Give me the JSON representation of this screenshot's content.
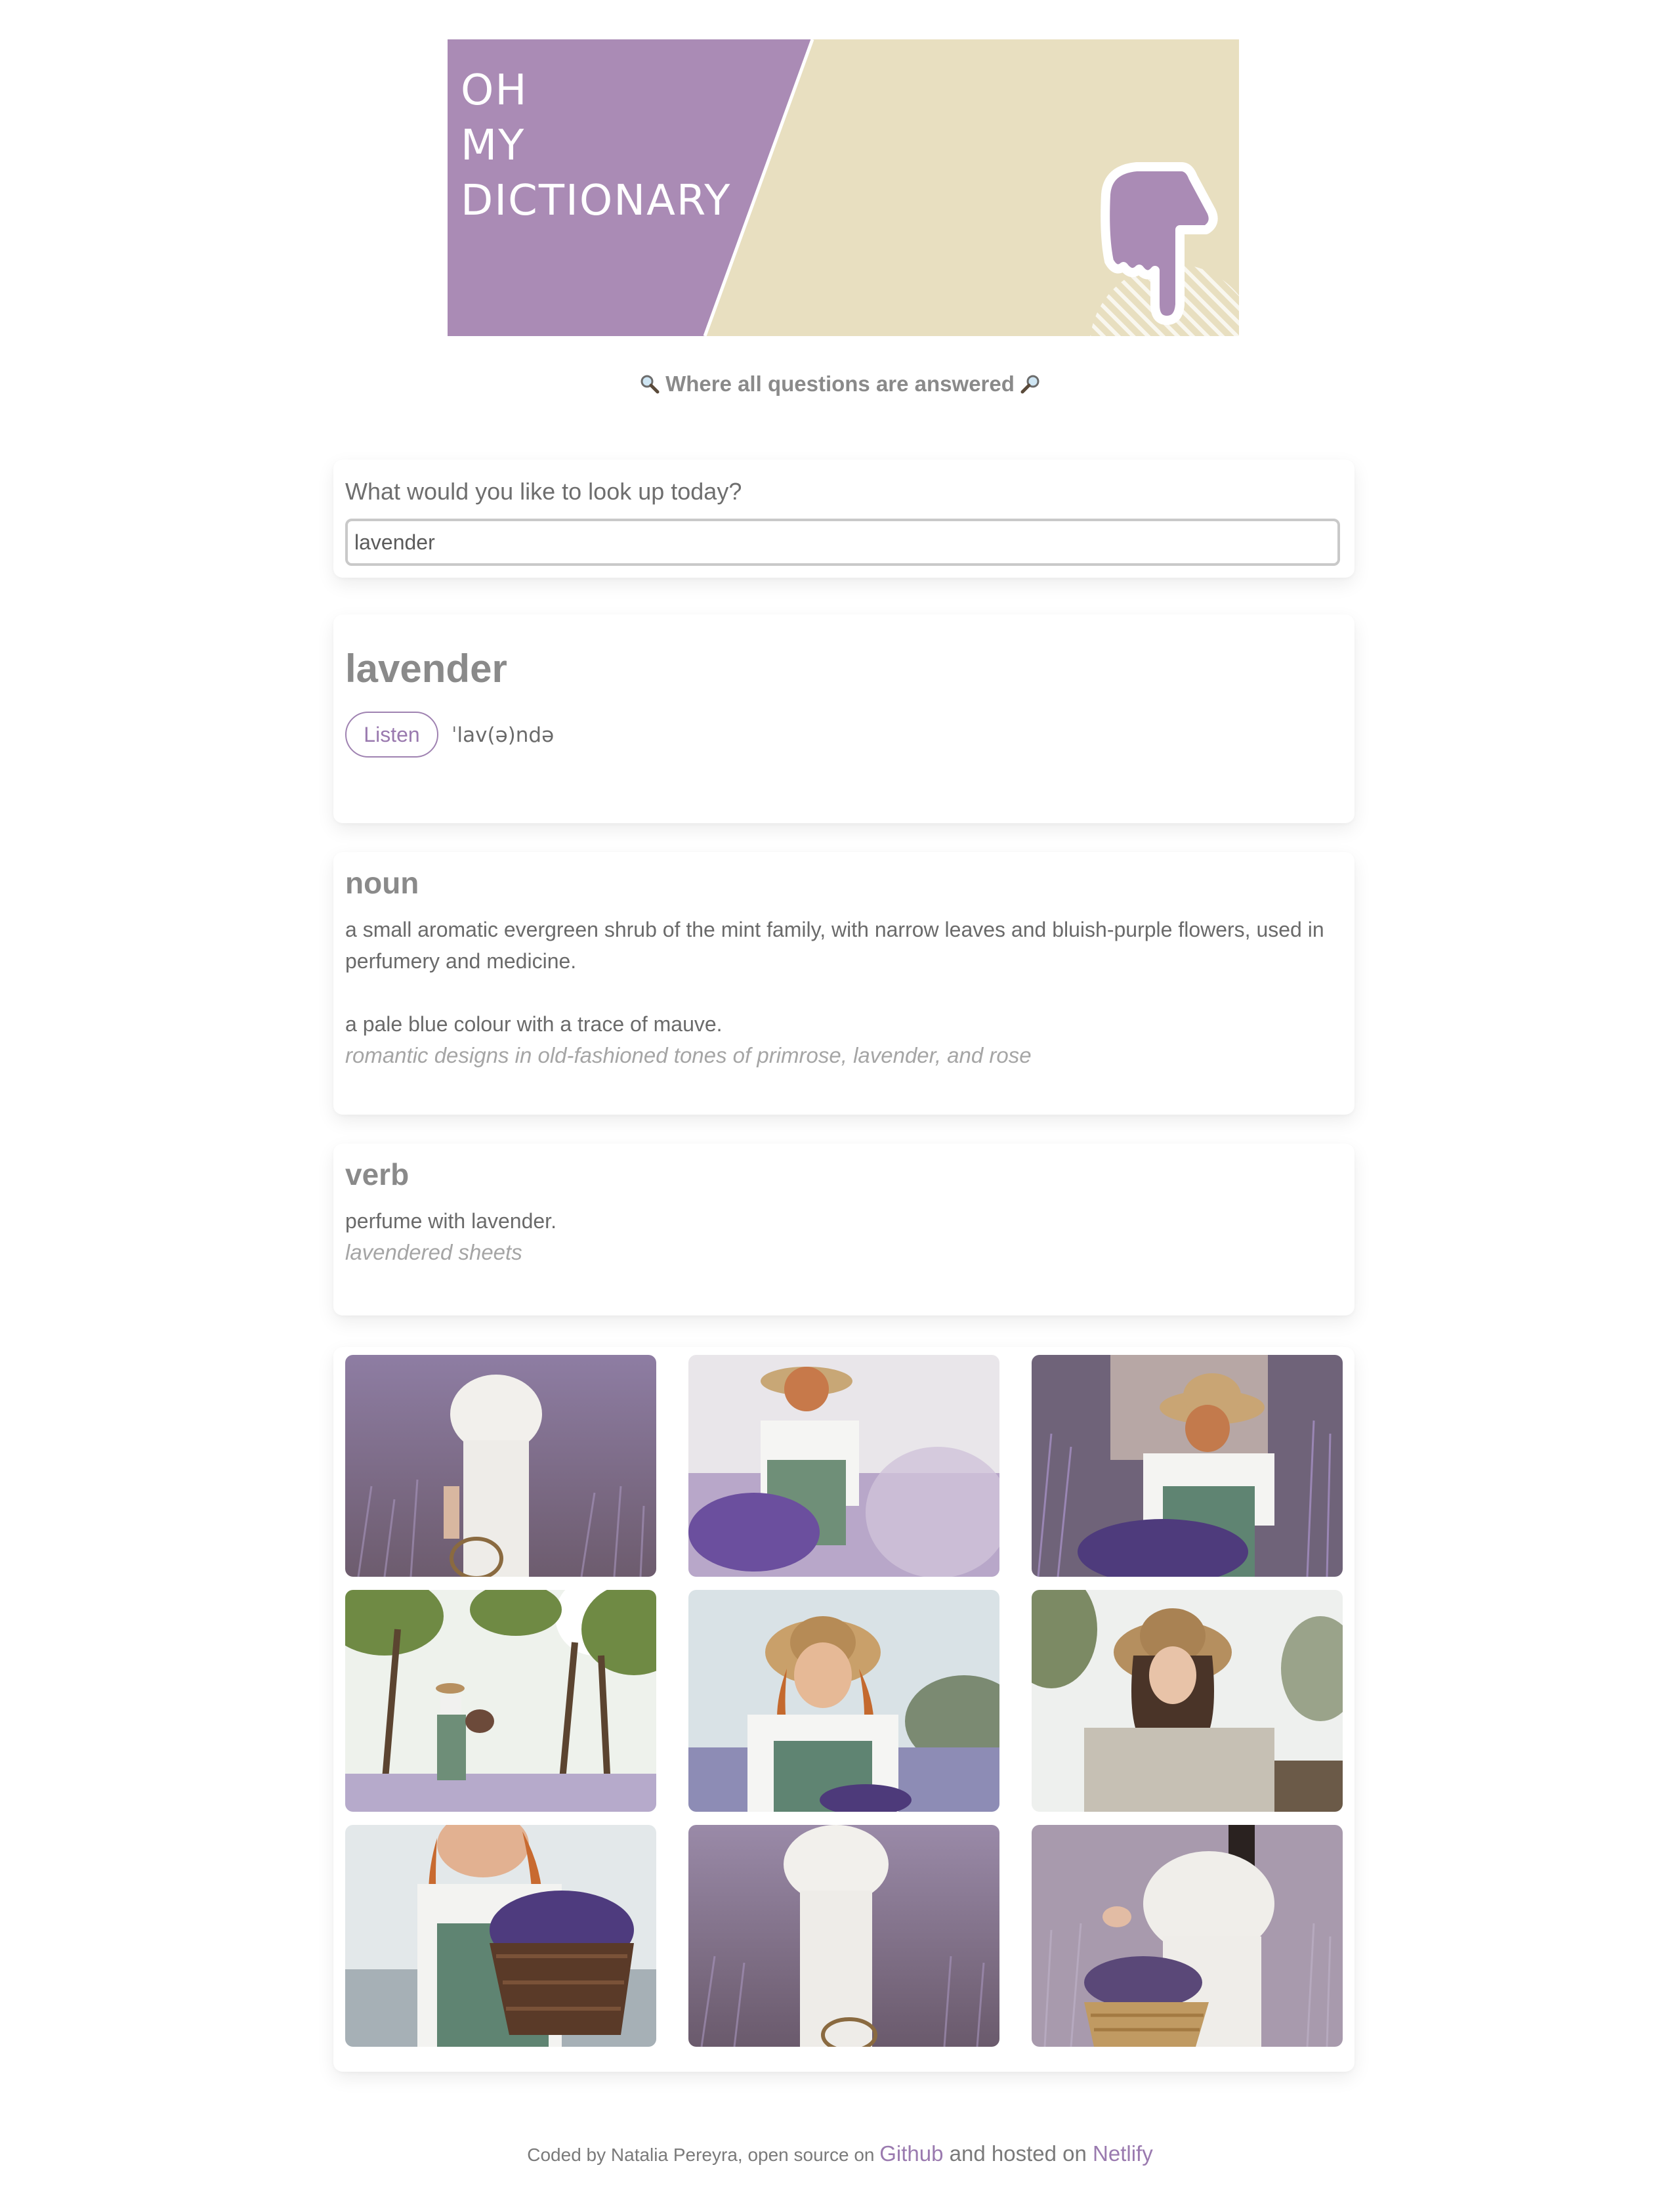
{
  "header": {
    "logo_lines": [
      "OH",
      "MY",
      "DICTIONARY"
    ],
    "tagline": "Where all questions are answered",
    "tagline_icon": "magnifying-glass-icon",
    "colors": {
      "purple": "#aa8bb5",
      "cream": "#e8dfc0"
    }
  },
  "search": {
    "label": "What would you like to look up today?",
    "value": "lavender"
  },
  "word": {
    "title": "lavender",
    "listen_label": "Listen",
    "phonetic": "ˈlav(ə)ndə"
  },
  "meanings": [
    {
      "part_of_speech": "noun",
      "definitions": [
        {
          "text": "a small aromatic evergreen shrub of the mint family, with narrow leaves and bluish-purple flowers, used in perfumery and medicine.",
          "example": ""
        },
        {
          "text": "a pale blue colour with a trace of mauve.",
          "example": "romantic designs in old-fashioned tones of primrose, lavender, and rose"
        }
      ]
    },
    {
      "part_of_speech": "verb",
      "definitions": [
        {
          "text": "perfume with lavender.",
          "example": "lavendered sheets"
        }
      ]
    }
  ],
  "photos": [
    {
      "name": "photo-woman-white-dress-lavender-field"
    },
    {
      "name": "photo-woman-hat-picking-lavender"
    },
    {
      "name": "photo-woman-hat-basket-lavender"
    },
    {
      "name": "photo-woman-walking-trees-basket"
    },
    {
      "name": "photo-woman-hat-smiling"
    },
    {
      "name": "photo-girl-hat-portrait"
    },
    {
      "name": "photo-woman-basket-lavender-bouquet"
    },
    {
      "name": "photo-woman-white-dress-field"
    },
    {
      "name": "photo-woman-wicker-basket-lavender"
    }
  ],
  "footer": {
    "prefix": "Coded by Natalia Pereyra, open source on ",
    "github_label": "Github",
    "middle": " and hosted on ",
    "netlify_label": "Netlify"
  }
}
